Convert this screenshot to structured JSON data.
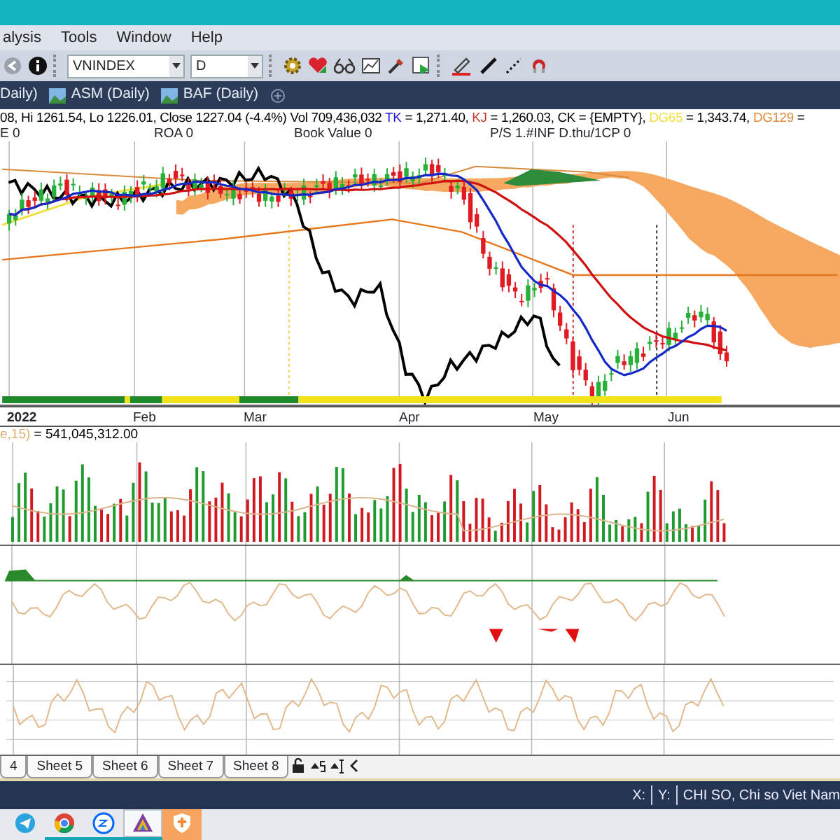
{
  "menu": [
    "alysis",
    "Tools",
    "Window",
    "Help"
  ],
  "toolbar": {
    "symbol": "VNINDEX",
    "interval": "D"
  },
  "chart_tabs": [
    "Daily)",
    "ASM (Daily)",
    "BAF (Daily)"
  ],
  "price_panel": {
    "info_line": [
      {
        "text": "08, Hi 1261.54, Lo 1226.01, Close 1227.04 (-4.4%) Vol 709,436,032 ",
        "color": "#000000"
      },
      {
        "text": "TK",
        "color": "#1a1adc"
      },
      {
        "text": " = 1,271.40, ",
        "color": "#000000"
      },
      {
        "text": "KJ",
        "color": "#c0392b"
      },
      {
        "text": " = 1,260.03, CK = {EMPTY}, ",
        "color": "#000000"
      },
      {
        "text": "DG65",
        "color": "#f0e040"
      },
      {
        "text": " = 1,343.74, ",
        "color": "#000000"
      },
      {
        "text": "DG129",
        "color": "#e08a3c"
      },
      {
        "text": " =",
        "color": "#000000"
      }
    ],
    "fundamentals": [
      "E 0",
      "ROA 0",
      "Book Value 0",
      "P/S 1.#INF D.thu/1CP 0"
    ],
    "x_labels": [
      "2022",
      "Feb",
      "Mar",
      "Apr",
      "May",
      "Jun"
    ]
  },
  "volume_panel": {
    "label": [
      {
        "text": "e,15)",
        "color": "#e0b070"
      },
      {
        "text": " = 541,045,312.00",
        "color": "#000000"
      }
    ]
  },
  "sheet_tabs": [
    "4",
    "Sheet 5",
    "Sheet 6",
    "Sheet 7",
    "Sheet 8"
  ],
  "status_bar": {
    "x": "X:",
    "y": "Y:",
    "symbol": "CHI SO, Chi so Viet Nam"
  },
  "taskbar": [
    {
      "kind": "telegram",
      "running": false,
      "selected": false
    },
    {
      "kind": "chrome",
      "running": true,
      "selected": false
    },
    {
      "kind": "zalo",
      "running": true,
      "selected": false
    },
    {
      "kind": "amibroker",
      "running": true,
      "selected": true
    },
    {
      "kind": "shield",
      "running": false,
      "selected": false
    }
  ]
}
